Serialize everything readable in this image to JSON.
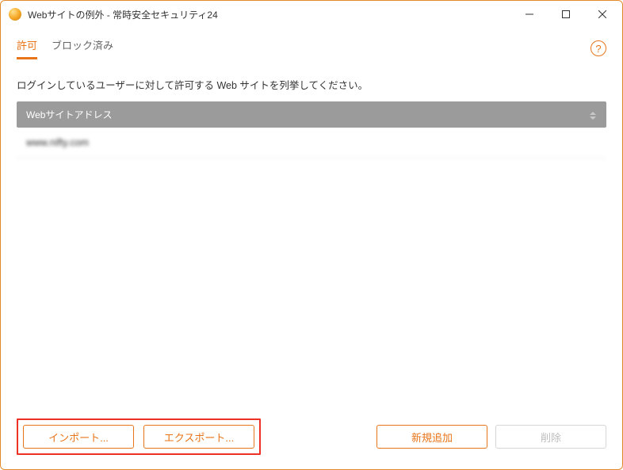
{
  "titlebar": {
    "title": "Webサイトの例外 - 常時安全セキュリティ24"
  },
  "tabs": {
    "allow": "許可",
    "blocked": "ブロック済み"
  },
  "instruction": "ログインしているユーザーに対して許可する Web サイトを列挙してください。",
  "table": {
    "header": "Webサイトアドレス",
    "rows": [
      "www.nifty.com"
    ]
  },
  "buttons": {
    "import": "インポート...",
    "export": "エクスポート...",
    "add": "新規追加",
    "delete": "削除"
  }
}
